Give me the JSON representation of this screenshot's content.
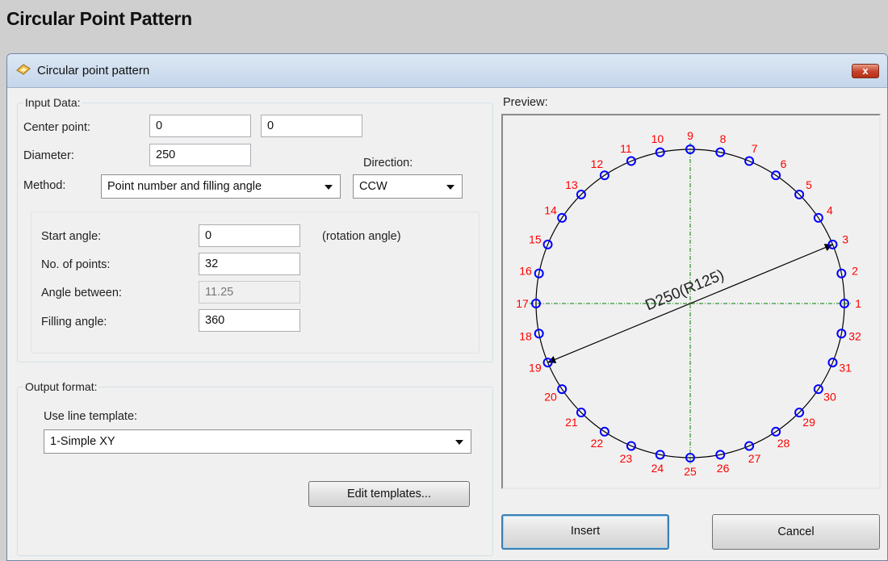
{
  "page": {
    "title": "Circular Point Pattern"
  },
  "dialog": {
    "title": "Circular point pattern",
    "close_label": "x",
    "input_group": {
      "label": "Input Data:",
      "center_label": "Center point:",
      "center_x": "0",
      "center_y": "0",
      "diameter_label": "Diameter:",
      "diameter": "250",
      "direction_label": "Direction:",
      "method_label": "Method:",
      "method_value": "Point number and filling angle",
      "direction_value": "CCW",
      "start_angle_label": "Start angle:",
      "start_angle": "0",
      "rotation_note": "(rotation angle)",
      "num_points_label": "No. of points:",
      "num_points": "32",
      "angle_between_label": "Angle between:",
      "angle_between": "11.25",
      "filling_angle_label": "Filling angle:",
      "filling_angle": "360"
    },
    "output_group": {
      "label": "Output format:",
      "template_label": "Use line template:",
      "template_value": "1-Simple XY",
      "edit_button": "Edit templates..."
    },
    "preview": {
      "label": "Preview:",
      "dimension_text": "D250(R125)",
      "point_count": 32,
      "point_color": "#0000ff",
      "label_color": "#ff0000",
      "axis_color": "#008000"
    },
    "insert_button": "Insert",
    "cancel_button": "Cancel"
  }
}
